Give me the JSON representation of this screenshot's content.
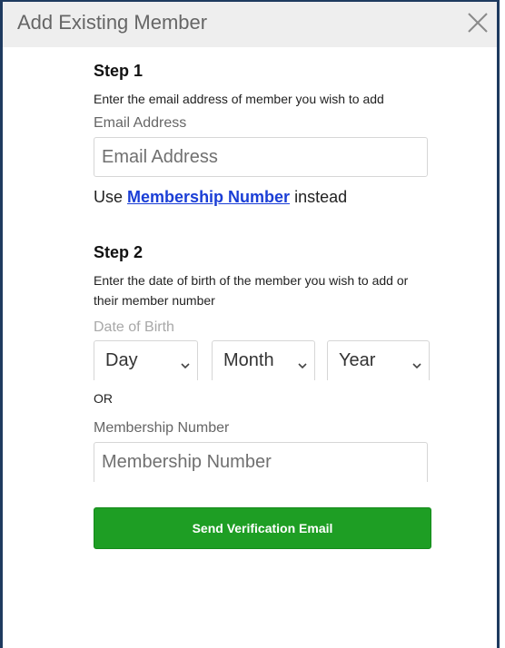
{
  "dialog": {
    "title": "Add Existing Member",
    "close_icon": "close-icon"
  },
  "step1": {
    "heading": "Step 1",
    "description": "Enter the email address of member you wish to add",
    "email_label": "Email Address",
    "email_placeholder": "Email Address",
    "email_value": "",
    "use_prefix": "Use",
    "use_link": "Membership Number",
    "use_suffix": "instead"
  },
  "step2": {
    "heading": "Step 2",
    "description": "Enter the date of birth of the member you wish to add or their member number",
    "dob_label": "Date of Birth",
    "day_value": "Day",
    "month_value": "Month",
    "year_value": "Year",
    "or_label": "OR",
    "membership_label": "Membership Number",
    "membership_placeholder": "Membership Number",
    "membership_value": ""
  },
  "actions": {
    "send_label": "Send Verification Email"
  },
  "colors": {
    "accent_green": "#1e9e24",
    "link_blue": "#1a3ed6",
    "border_navy": "#1e3a5f"
  }
}
